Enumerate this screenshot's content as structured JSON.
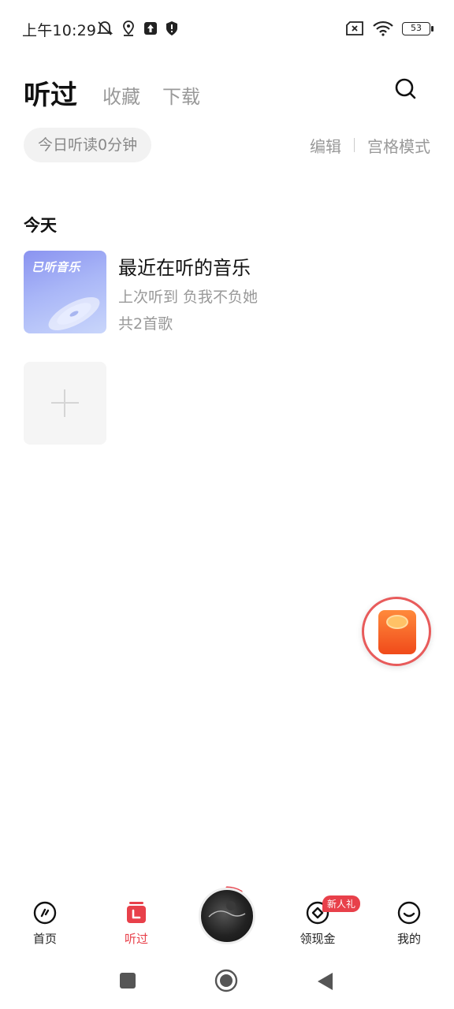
{
  "status_bar": {
    "time": "上午10:29",
    "battery": "53",
    "icons_left": [
      "mute-bell-icon",
      "location-icon",
      "upload-icon",
      "shield-icon"
    ],
    "icons_right": [
      "sim-none-icon",
      "wifi-icon",
      "battery-icon"
    ]
  },
  "header": {
    "tabs": [
      {
        "label": "听过",
        "active": true
      },
      {
        "label": "收藏",
        "active": false
      },
      {
        "label": "下载",
        "active": false
      }
    ]
  },
  "toolbar": {
    "listen_pill": "今日听读0分钟",
    "edit": "编辑",
    "grid_mode": "宫格模式"
  },
  "section": {
    "title": "今天",
    "playlist": {
      "cover_text": "已听音乐",
      "title": "最近在听的音乐",
      "last_played": "上次听到 负我不负她",
      "count": "共2首歌"
    }
  },
  "bottom_nav": {
    "items": [
      {
        "label": "首页",
        "icon": "home-icon"
      },
      {
        "label": "听过",
        "icon": "listened-icon",
        "active": true
      },
      {
        "label": "领现金",
        "icon": "cash-icon",
        "badge": "新人礼"
      },
      {
        "label": "我的",
        "icon": "profile-icon"
      }
    ]
  },
  "colors": {
    "accent": "#e8404a",
    "inactive_text": "#999999",
    "cover_gradient_start": "#8a93f0"
  }
}
